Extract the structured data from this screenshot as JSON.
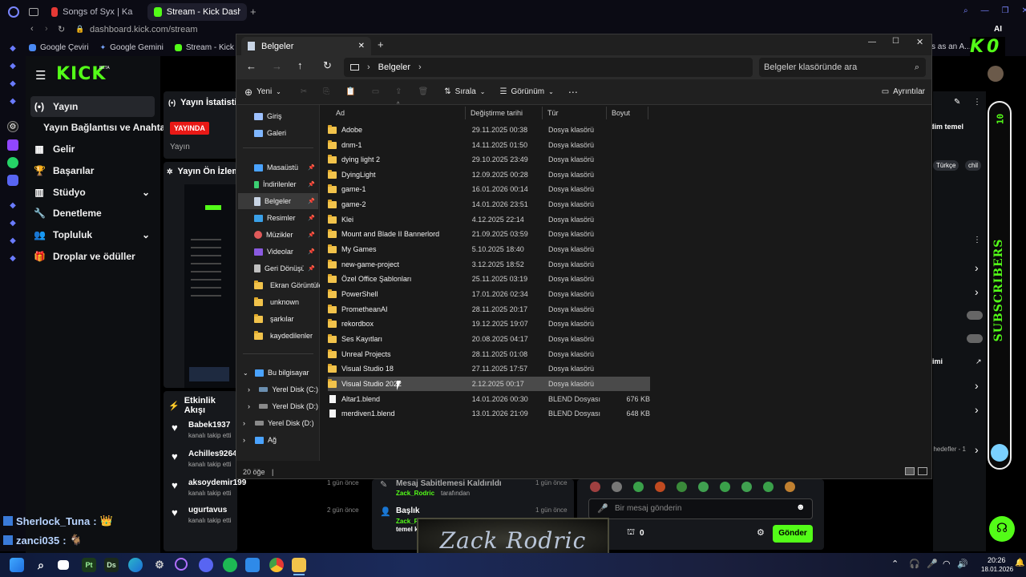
{
  "browser": {
    "tabs": [
      {
        "label": "Songs of Syx | Kapsamlı B",
        "color": "#e53935"
      },
      {
        "label": "Stream - Kick Dashboa",
        "color": "#53fc18"
      }
    ],
    "url": "dashboard.kick.com/stream",
    "bookmarks": [
      "Google Çeviri",
      "Google Gemini",
      "Stream - Kick Das..."
    ],
    "right_text": "s as an A...",
    "ai_label": "AI"
  },
  "kick": {
    "logo": "KICK",
    "beta": "BETA",
    "nav": [
      {
        "label": "Yayın",
        "icon": "(•)"
      },
      {
        "label": "Yayın Bağlantısı ve Anahtarı",
        "icon": ""
      },
      {
        "label": "Gelir",
        "icon": "▦"
      },
      {
        "label": "Başarılar",
        "icon": "🏆"
      },
      {
        "label": "Stüdyo",
        "icon": "▥"
      },
      {
        "label": "Denetleme",
        "icon": "🔧"
      },
      {
        "label": "Topluluk",
        "icon": "👥"
      },
      {
        "label": "Droplar ve ödüller",
        "icon": "🎁"
      }
    ],
    "stats_title": "Yayın İstatistikl",
    "live_badge": "YAYINDA",
    "stream_label": "Yayın",
    "preview_title": "Yayın Ön İzleme",
    "activity_title": "Etkinlik Akışı",
    "activity": [
      {
        "user": "Babek1937",
        "sub": "kanalı takip etti",
        "time": ""
      },
      {
        "user": "Achilles9264",
        "sub": "kanalı takip etti",
        "time": ""
      },
      {
        "user": "aksoydemir199",
        "sub": "kanalı takip etti",
        "time": "1 gün önce"
      },
      {
        "user": "ugurtavus",
        "sub": "kanalı takip etti",
        "time": "2 gün önce"
      }
    ],
    "mod_log": [
      {
        "title": "Mesaj Sabitlemesi Kaldırıldı",
        "sub": "Zack_Rodric",
        "sub2": "tarafından",
        "time": "1 gün önce"
      },
      {
        "title": "Başlık",
        "sub": "Zack_R",
        "sub2": "temel k",
        "time": "1 gün önce"
      }
    ],
    "chat_placeholder": "Bir mesaj gönderin",
    "send_label": "Gönder",
    "points": "0",
    "right_fragment": "dim temel",
    "tags": [
      "Türkçe",
      "chil"
    ],
    "goals_fragment": "f hedefler - 1",
    "goals_fragment2": "timi"
  },
  "chat_overlay": [
    {
      "user": "Sherlock_Tuna",
      "emote": "👑"
    },
    {
      "user": "zanci035",
      "emote": "🐐"
    }
  ],
  "banner_text": "Zack Rodric",
  "subscribers": {
    "label": "SUBSCRIBERS",
    "count": "10"
  },
  "ko_badge": "K0",
  "explorer": {
    "tab_title": "Belgeler",
    "breadcrumb": "Belgeler",
    "search_placeholder": "Belgeler klasöründe ara",
    "cmd": {
      "new": "Yeni",
      "sort": "Sırala",
      "view": "Görünüm",
      "details": "Ayrıntılar"
    },
    "nav": [
      {
        "label": "Giriş",
        "icon": "home",
        "color": "#9ec1ff",
        "pin": false
      },
      {
        "label": "Galeri",
        "icon": "gallery",
        "color": "#7fb6ff",
        "pin": false
      },
      {
        "label": "Masaüstü",
        "icon": "desktop",
        "color": "#4aa3ff",
        "pin": true
      },
      {
        "label": "İndirilenler",
        "icon": "download",
        "color": "#3ccf73",
        "pin": true
      },
      {
        "label": "Belgeler",
        "icon": "document",
        "color": "#9ab0c8",
        "pin": true
      },
      {
        "label": "Resimler",
        "icon": "pictures",
        "color": "#3aa0e8",
        "pin": true
      },
      {
        "label": "Müzikler",
        "icon": "music",
        "color": "#e05a5a",
        "pin": true
      },
      {
        "label": "Videolar",
        "icon": "video",
        "color": "#8a5ae0",
        "pin": true
      },
      {
        "label": "Geri Dönüşüm K",
        "icon": "recycle",
        "color": "#c0c0c0",
        "pin": true
      },
      {
        "label": "Ekran Görüntüleri",
        "icon": "folder",
        "color": "#f2c34b",
        "pin": false
      },
      {
        "label": "unknown",
        "icon": "folder",
        "color": "#f2c34b",
        "pin": false
      },
      {
        "label": "şarkılar",
        "icon": "folder",
        "color": "#f2c34b",
        "pin": false
      },
      {
        "label": "kaydedilenler",
        "icon": "folder",
        "color": "#f2c34b",
        "pin": false
      }
    ],
    "tree": [
      {
        "label": "Bu bilgisayar",
        "indent": 0,
        "color": "#4aa3ff"
      },
      {
        "label": "Yerel Disk (C:)",
        "indent": 1,
        "color": "#6b8fb0"
      },
      {
        "label": "Yerel Disk (D:)",
        "indent": 1,
        "color": "#8a8a8a"
      },
      {
        "label": "Yerel Disk (D:)",
        "indent": 0,
        "color": "#8a8a8a"
      },
      {
        "label": "Ağ",
        "indent": 0,
        "color": "#4aa3ff"
      }
    ],
    "columns": {
      "name": "Ad",
      "date": "Değiştirme tarihi",
      "type": "Tür",
      "size": "Boyut"
    },
    "files": [
      {
        "name": "Adobe",
        "date": "29.11.2025 00:38",
        "type": "Dosya klasörü",
        "size": "",
        "kind": "folder"
      },
      {
        "name": "dnm-1",
        "date": "14.11.2025 01:50",
        "type": "Dosya klasörü",
        "size": "",
        "kind": "folder"
      },
      {
        "name": "dying light 2",
        "date": "29.10.2025 23:49",
        "type": "Dosya klasörü",
        "size": "",
        "kind": "folder"
      },
      {
        "name": "DyingLight",
        "date": "12.09.2025 00:28",
        "type": "Dosya klasörü",
        "size": "",
        "kind": "folder"
      },
      {
        "name": "game-1",
        "date": "16.01.2026 00:14",
        "type": "Dosya klasörü",
        "size": "",
        "kind": "folder"
      },
      {
        "name": "game-2",
        "date": "14.01.2026 23:51",
        "type": "Dosya klasörü",
        "size": "",
        "kind": "folder"
      },
      {
        "name": "Klei",
        "date": "4.12.2025 22:14",
        "type": "Dosya klasörü",
        "size": "",
        "kind": "folder"
      },
      {
        "name": "Mount and Blade II Bannerlord",
        "date": "21.09.2025 03:59",
        "type": "Dosya klasörü",
        "size": "",
        "kind": "folder"
      },
      {
        "name": "My Games",
        "date": "5.10.2025 18:40",
        "type": "Dosya klasörü",
        "size": "",
        "kind": "folder"
      },
      {
        "name": "new-game-project",
        "date": "3.12.2025 18:52",
        "type": "Dosya klasörü",
        "size": "",
        "kind": "folder"
      },
      {
        "name": "Özel Office Şablonları",
        "date": "25.11.2025 03:19",
        "type": "Dosya klasörü",
        "size": "",
        "kind": "folder"
      },
      {
        "name": "PowerShell",
        "date": "17.01.2026 02:34",
        "type": "Dosya klasörü",
        "size": "",
        "kind": "folder"
      },
      {
        "name": "PrometheanAI",
        "date": "28.11.2025 20:17",
        "type": "Dosya klasörü",
        "size": "",
        "kind": "folder"
      },
      {
        "name": "rekordbox",
        "date": "19.12.2025 19:07",
        "type": "Dosya klasörü",
        "size": "",
        "kind": "folder"
      },
      {
        "name": "Ses Kayıtları",
        "date": "20.08.2025 04:17",
        "type": "Dosya klasörü",
        "size": "",
        "kind": "folder"
      },
      {
        "name": "Unreal Projects",
        "date": "28.11.2025 01:08",
        "type": "Dosya klasörü",
        "size": "",
        "kind": "folder"
      },
      {
        "name": "Visual Studio 18",
        "date": "27.11.2025 17:57",
        "type": "Dosya klasörü",
        "size": "",
        "kind": "folder"
      },
      {
        "name": "Visual Studio 2022",
        "date": "2.12.2025 00:17",
        "type": "Dosya klasörü",
        "size": "",
        "kind": "folder",
        "selected": true
      },
      {
        "name": "Altar1.blend",
        "date": "14.01.2026 00:30",
        "type": "BLEND Dosyası",
        "size": "676 KB",
        "kind": "file"
      },
      {
        "name": "merdiven1.blend",
        "date": "13.01.2026 21:09",
        "type": "BLEND Dosyası",
        "size": "648 KB",
        "kind": "file"
      }
    ],
    "status": "20 öğe"
  },
  "taskbar": {
    "clock_time": "20:26",
    "clock_date": "18.01.2026",
    "apps": [
      "Pt",
      "Ds"
    ]
  }
}
